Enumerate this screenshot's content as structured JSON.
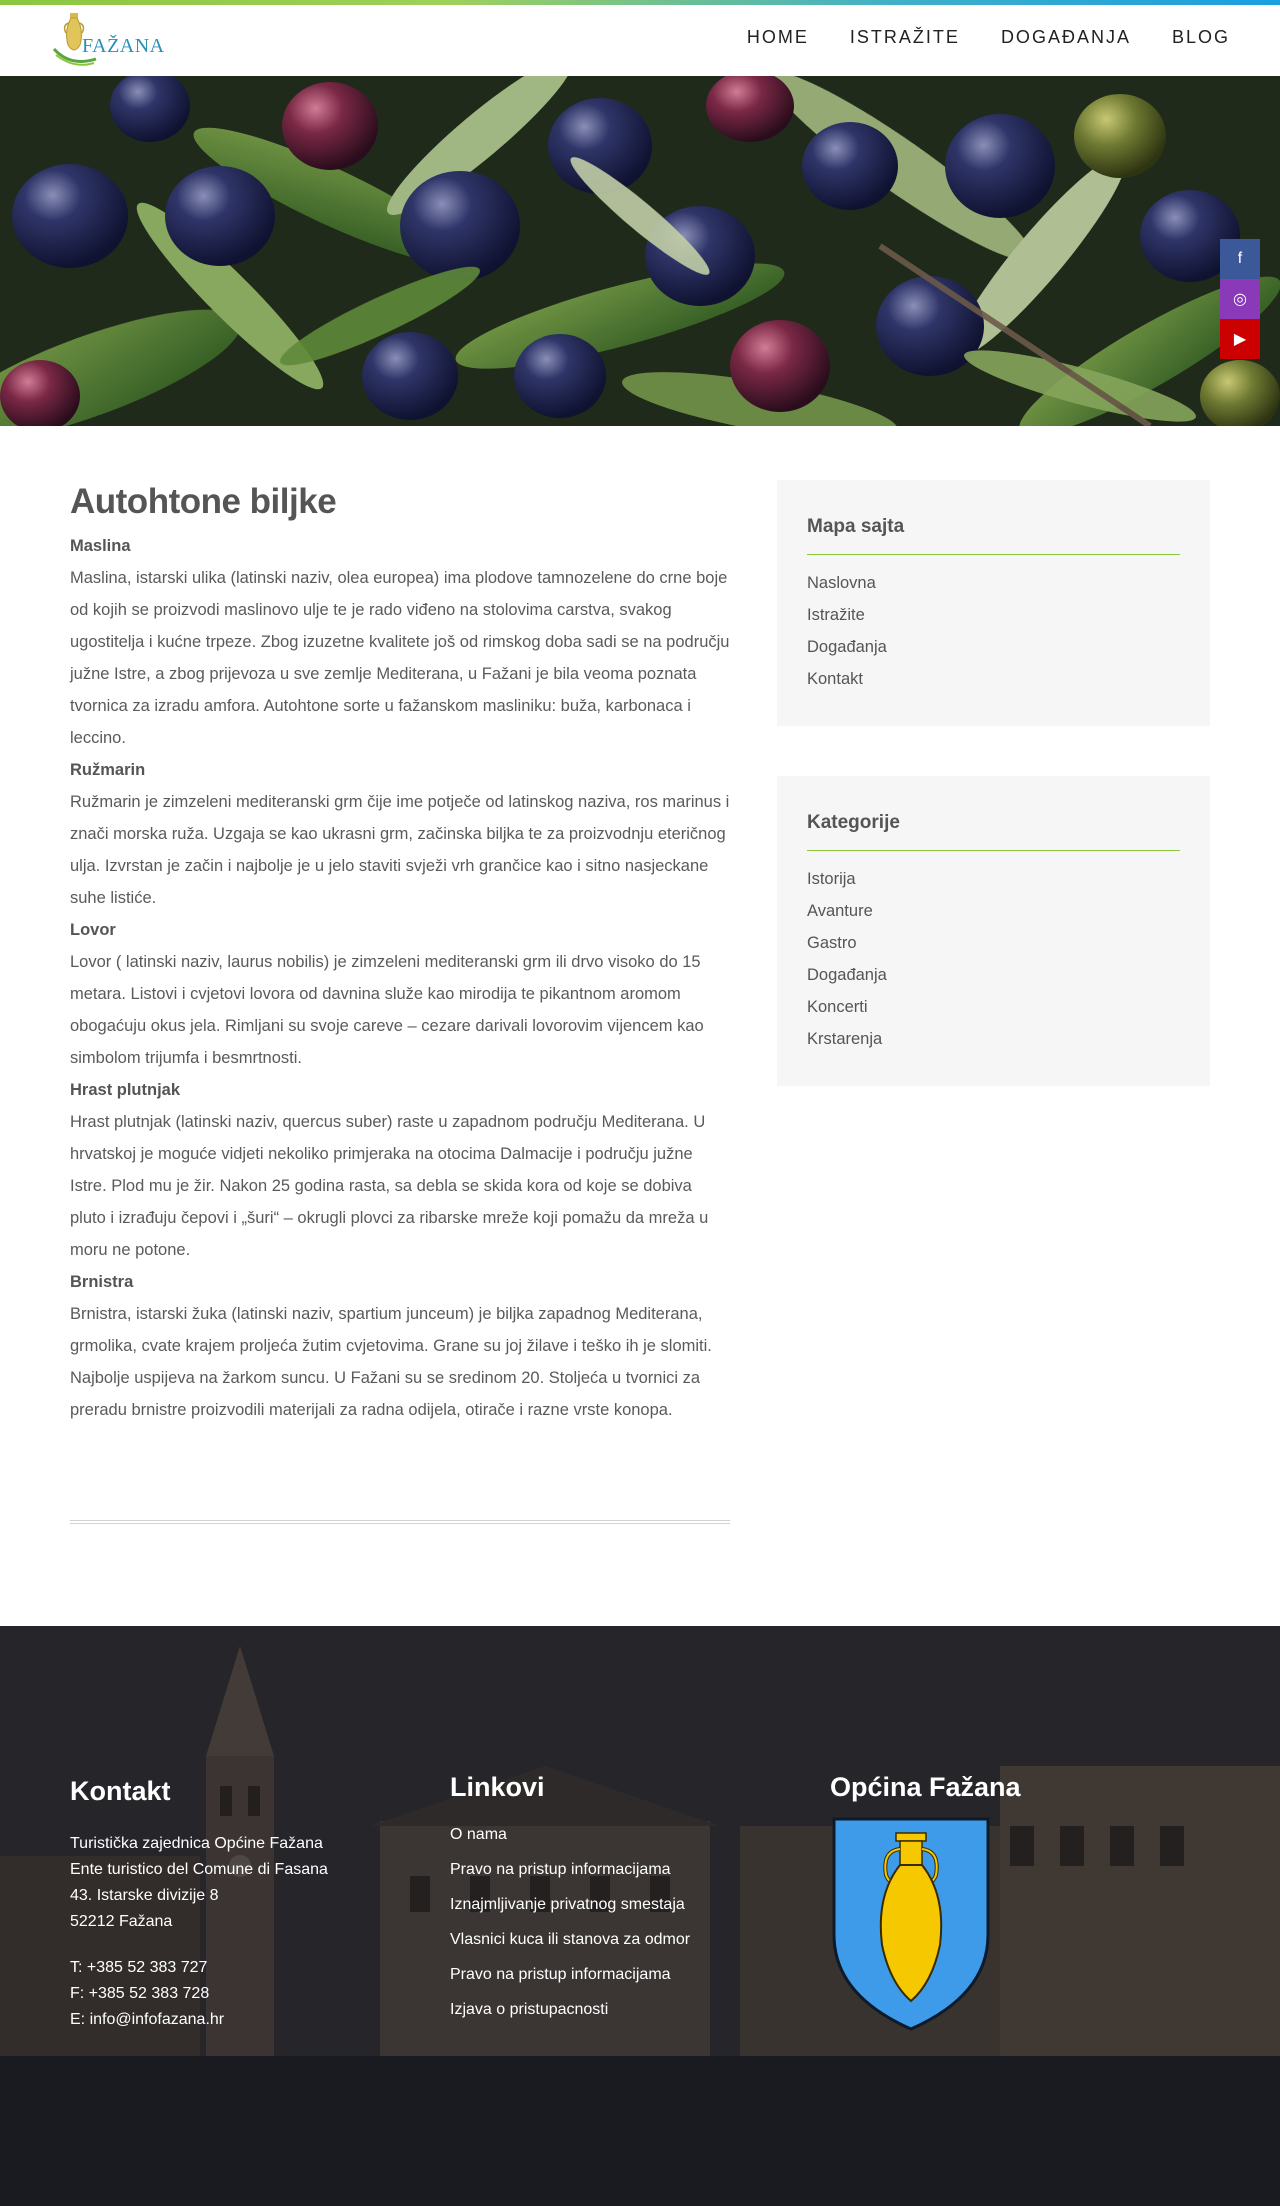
{
  "header": {
    "logo_text": "FAŽANA",
    "nav": [
      "HOME",
      "ISTRAŽITE",
      "DOGAĐANJA",
      "BLOG"
    ]
  },
  "hero": {
    "image": "olives-and-leaves-photo"
  },
  "social": [
    {
      "name": "facebook-icon",
      "glyph": "f",
      "color": "#3b5998"
    },
    {
      "name": "instagram-icon",
      "glyph": "◎",
      "color": "#8a3ab9"
    },
    {
      "name": "youtube-icon",
      "glyph": "▶",
      "color": "#cc0000"
    }
  ],
  "main": {
    "title": "Autohtone biljke",
    "sections": [
      {
        "heading": "Maslina",
        "text": "Maslina, istarski ulika (latinski naziv, olea europea) ima plodove tamnozelene do crne boje od kojih se proizvodi maslinovo ulje te je rado viđeno na stolovima carstva, svakog ugostitelja i kućne trpeze. Zbog izuzetne kvalitete još od rimskog doba sadi se na području južne Istre, a zbog prijevoza u sve zemlje Mediterana, u Fažani je bila veoma poznata tvornica za izradu amfora. Autohtone sorte u fažanskom masliniku: buža, karbonaca i leccino."
      },
      {
        "heading": "Ružmarin",
        "text": "Ružmarin je zimzeleni mediteranski grm čije ime potječe od latinskog naziva, ros marinus i znači morska ruža. Uzgaja se kao ukrasni grm, začinska biljka te za proizvodnju eteričnog ulja. Izvrstan je začin i najbolje je u jelo staviti svježi vrh grančice kao i sitno nasjeckane suhe listiće."
      },
      {
        "heading": "Lovor",
        "text": "Lovor ( latinski naziv, laurus nobilis) je zimzeleni mediteranski grm ili drvo visoko do 15 metara. Listovi i cvjetovi lovora od davnina služe kao mirodija te pikantnom aromom obogaćuju okus jela. Rimljani su svoje careve – cezare darivali lovorovim vijencem kao simbolom trijumfa i besmrtnosti."
      },
      {
        "heading": "Hrast plutnjak",
        "text": "Hrast plutnjak (latinski naziv, quercus suber) raste u zapadnom području Mediterana. U hrvatskoj je moguće vidjeti nekoliko primjeraka na otocima Dalmacije i području južne Istre. Plod mu je žir. Nakon 25 godina rasta, sa debla se skida kora od koje se dobiva pluto i izrađuju čepovi i „šuri“ – okrugli plovci za ribarske mreže koji pomažu da mreža u moru ne potone."
      },
      {
        "heading": "Brnistra",
        "text": "Brnistra, istarski žuka (latinski naziv, spartium junceum) je biljka zapadnog Mediterana, grmolika, cvate krajem proljeća žutim cvjetovima. Grane su joj žilave i teško ih je slomiti. Najbolje uspijeva na žarkom suncu. U Fažani su se sredinom 20. Stoljeća u tvornici za preradu brnistre proizvodili materijali za radna odijela, otirače i razne vrste konopa."
      }
    ]
  },
  "sidebar": {
    "sitemap": {
      "title": "Mapa sajta",
      "items": [
        "Naslovna",
        "Istražite",
        "Događanja",
        "Kontakt"
      ]
    },
    "categories": {
      "title": "Kategorije",
      "items": [
        "Istorija",
        "Avanture",
        "Gastro",
        "Događanja",
        "Koncerti",
        "Krstarenja"
      ]
    }
  },
  "footer": {
    "contact": {
      "title": "Kontakt",
      "address": [
        "Turistička zajednica Općine Fažana",
        "Ente turistico del Comune di Fasana",
        "43. Istarske divizije 8",
        "52212 Fažana"
      ],
      "phones": [
        "T: +385 52 383 727",
        "F: +385 52 383 728",
        "E: info@infofazana.hr"
      ]
    },
    "links": {
      "title": "Linkovi",
      "items": [
        "O nama",
        "Pravo na pristup informacijama",
        "Iznajmljivanje privatnog smestaja",
        "Vlasnici kuca ili stanova za odmor",
        "Pravo na pristup informacijama",
        "Izjava o pristupacnosti"
      ]
    },
    "municipality": {
      "title": "Općina Fažana",
      "emblem": "coat-of-arms-amphora"
    }
  },
  "colors": {
    "accent_green": "#8cc63f",
    "accent_blue": "#1a9fe0",
    "sidebar_bg": "#f6f6f6",
    "emblem_blue": "#3d9bea",
    "emblem_gold": "#f6c800"
  }
}
